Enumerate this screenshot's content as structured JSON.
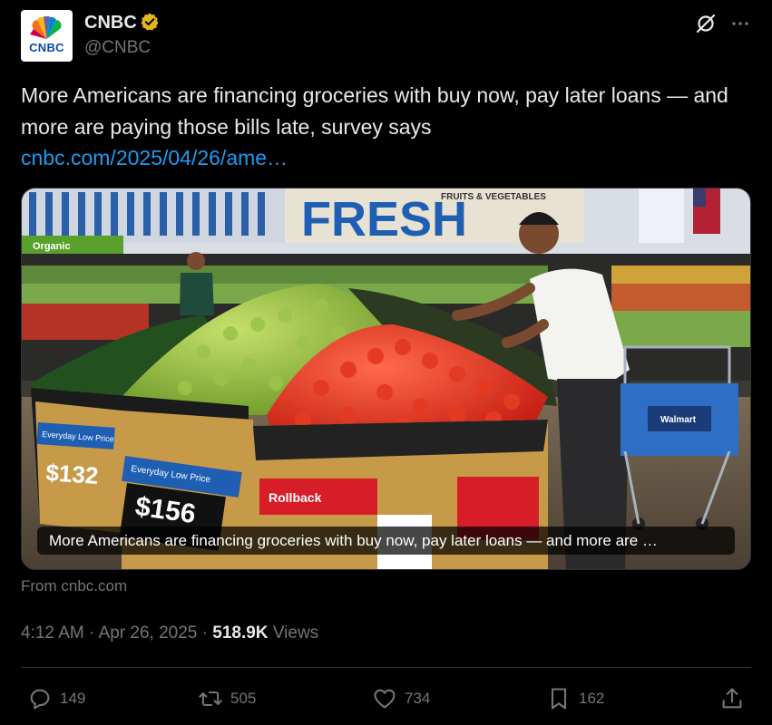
{
  "author": {
    "display_name": "CNBC",
    "handle": "@CNBC",
    "avatar_text": "CNBC",
    "verified": true,
    "verified_color": "#e2b719"
  },
  "tweet": {
    "text": "More Americans are financing groceries with buy now, pay later loans — and more are paying those bills late, survey says",
    "link": "cnbc.com/2025/04/26/ame…"
  },
  "media": {
    "caption": "More Americans are financing groceries with buy now, pay later loans — and more are …",
    "sign_fresh": "FRESH",
    "sign_fruits": "FRUITS & VEGETABLES",
    "sign_organic": "Organic",
    "sign_rollback": "Rollback",
    "sign_everyday_1": "Everyday Low Price",
    "sign_everyday_2": "Everyday Low Price",
    "price_1": "$132",
    "price_2": "$156",
    "walmart": "Walmart"
  },
  "source": "From cnbc.com",
  "meta": {
    "time": "4:12 AM",
    "separator": "·",
    "date": "Apr 26, 2025",
    "views_count": "518.9K",
    "views_label": "Views"
  },
  "actions": {
    "replies": "149",
    "reposts": "505",
    "likes": "734",
    "bookmarks": "162"
  },
  "colors": {
    "background": "#000000",
    "text": "#e7e9ea",
    "muted": "#71767b",
    "link": "#1d9bf0",
    "divider": "#2f3336"
  }
}
